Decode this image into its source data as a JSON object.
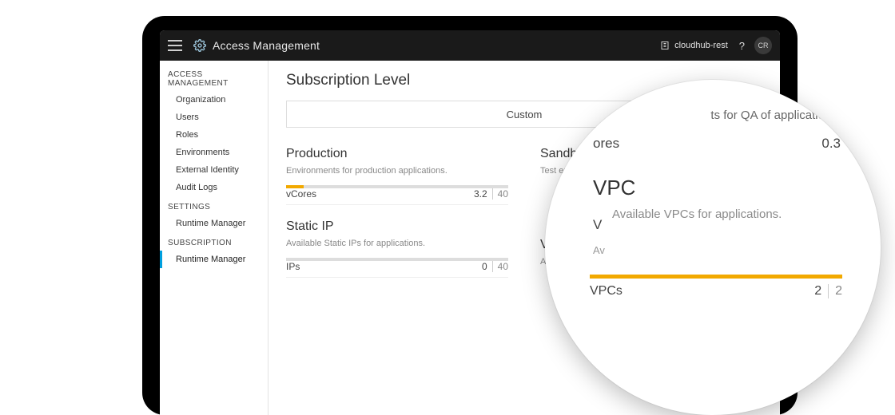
{
  "topbar": {
    "title": "Access Management",
    "org_name": "cloudhub-rest",
    "help": "?",
    "avatar_initials": "CR"
  },
  "sidebar": {
    "sections": [
      {
        "title": "ACCESS MANAGEMENT",
        "items": [
          {
            "label": "Organization"
          },
          {
            "label": "Users"
          },
          {
            "label": "Roles"
          },
          {
            "label": "Environments"
          },
          {
            "label": "External Identity"
          },
          {
            "label": "Audit Logs"
          }
        ]
      },
      {
        "title": "SETTINGS",
        "items": [
          {
            "label": "Runtime Manager"
          }
        ]
      },
      {
        "title": "SUBSCRIPTION",
        "items": [
          {
            "label": "Runtime Manager",
            "active": true
          }
        ]
      }
    ]
  },
  "main": {
    "page_title": "Subscription Level",
    "plan_label": "Custom",
    "production": {
      "heading": "Production",
      "subheading": "Environments for production applications.",
      "metric_name": "vCores",
      "metric_value": "3.2",
      "metric_max": "40",
      "fill_pct": 8
    },
    "static_ip": {
      "heading": "Static IP",
      "subheading": "Available Static IPs for applications.",
      "metric_name": "IPs",
      "metric_value": "0",
      "metric_max": "40",
      "fill_pct": 0
    },
    "sandbox": {
      "heading_visible": "Sandbo",
      "subheading_visible": "Test env"
    },
    "vpc_peek": {
      "v_label": "V",
      "av_label": "Av"
    }
  },
  "lens": {
    "faded_top_text": "ts for QA of applications.",
    "ores_label": "ores",
    "ores_value": "0.3",
    "vpc_heading": "VPC",
    "vpc_sub": "Available VPCs for applications.",
    "v_letter": "V",
    "av_letter": "Av",
    "vpcs_label": "VPCs",
    "vpcs_value": "2",
    "vpcs_max": "2",
    "fill_pct": 100
  },
  "colors": {
    "accent": "#f2a900",
    "topbar_bg": "#1a1a1a"
  }
}
